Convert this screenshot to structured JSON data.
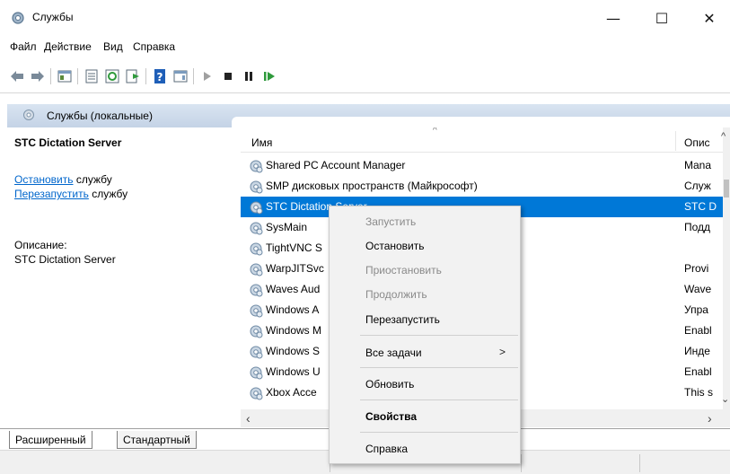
{
  "window": {
    "title": "Службы",
    "minimize": "—",
    "maximize": "☐",
    "close": "✕"
  },
  "menu": [
    "Файл",
    "Действие",
    "Вид",
    "Справка"
  ],
  "scope_header": "Службы (локальные)",
  "left_pane": {
    "service_title": "STC Dictation Server",
    "stop_link": "Остановить",
    "stop_suffix": " службу",
    "restart_link": "Перезапустить",
    "restart_suffix": " службу",
    "desc_label": "Описание:",
    "desc_value": "STC Dictation Server"
  },
  "columns": {
    "name": "Имя",
    "description": "Опис"
  },
  "rows": [
    {
      "name": "Shared PC Account Manager",
      "desc": "Mana"
    },
    {
      "name": "SMP дисковых пространств (Майкрософт)",
      "desc": "Служ"
    },
    {
      "name": "STC Dictation Server",
      "desc": "STC D",
      "selected": true
    },
    {
      "name": "SysMain",
      "desc": "Подд"
    },
    {
      "name": "TightVNC S",
      "desc": ""
    },
    {
      "name": "WarpJITSvc",
      "desc": "Provi"
    },
    {
      "name": "Waves Aud",
      "desc": "Wave"
    },
    {
      "name": "Windows A",
      "desc": "Упра"
    },
    {
      "name": "Windows M",
      "desc": "Enabl"
    },
    {
      "name": "Windows S",
      "desc": "Инде"
    },
    {
      "name": "Windows U",
      "desc": "Enabl"
    },
    {
      "name": "Xbox Acce",
      "desc": "This s"
    }
  ],
  "tabs": {
    "extended": "Расширенный",
    "standard": "Стандартный"
  },
  "context_menu": {
    "start": "Запустить",
    "stop": "Остановить",
    "pause": "Приостановить",
    "resume": "Продолжить",
    "restart": "Перезапустить",
    "all_tasks": "Все задачи",
    "refresh": "Обновить",
    "properties": "Свойства",
    "help": "Справка"
  },
  "colors": {
    "selection": "#0078d7",
    "link": "#0066cc",
    "header_bar": "#c4d3e6"
  }
}
